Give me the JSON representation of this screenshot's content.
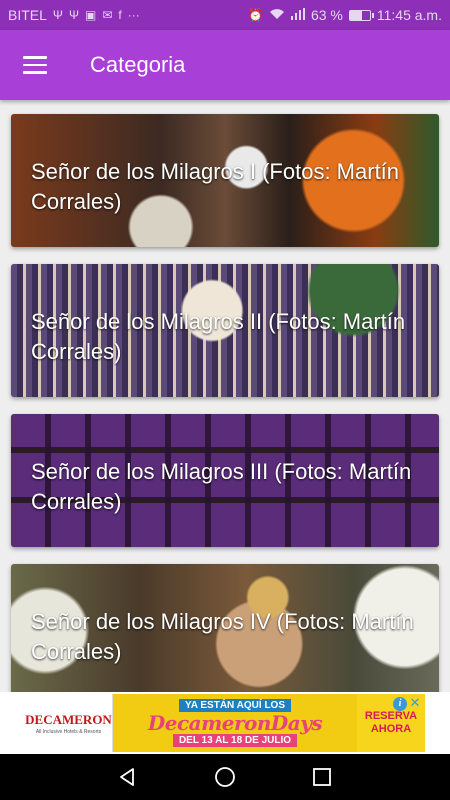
{
  "status_bar": {
    "carrier": "BITEL",
    "battery_percent": "63 %",
    "battery_level": 0.63,
    "time": "11:45 a.m."
  },
  "app_bar": {
    "title": "Categoria",
    "menu_icon": "hamburger-menu-icon"
  },
  "categories": [
    {
      "title": "Señor de los Milagros I (Fotos: Martín Corrales)"
    },
    {
      "title": "Señor de los Milagros II (Fotos: Martín Corrales)"
    },
    {
      "title": "Señor de los Milagros III (Fotos: Martín Corrales)"
    },
    {
      "title": "Señor de los Milagros IV (Fotos: Martín Corrales)"
    }
  ],
  "ad": {
    "brand": "DECAMERON",
    "brand_sub": "All Inclusive Hotels & Resorts",
    "top_line": "YA ESTÁN AQUÍ LOS",
    "headline": "DecameronDays",
    "dates": "DEL 13 AL 18 DE JULIO",
    "cta_line1": "RESERVA",
    "cta_line2": "AHORA",
    "info_glyph": "i",
    "close_glyph": "✕"
  },
  "colors": {
    "status_bar": "#8e2fb7",
    "app_bar": "#a83fd6",
    "nav_bar": "#000000"
  }
}
